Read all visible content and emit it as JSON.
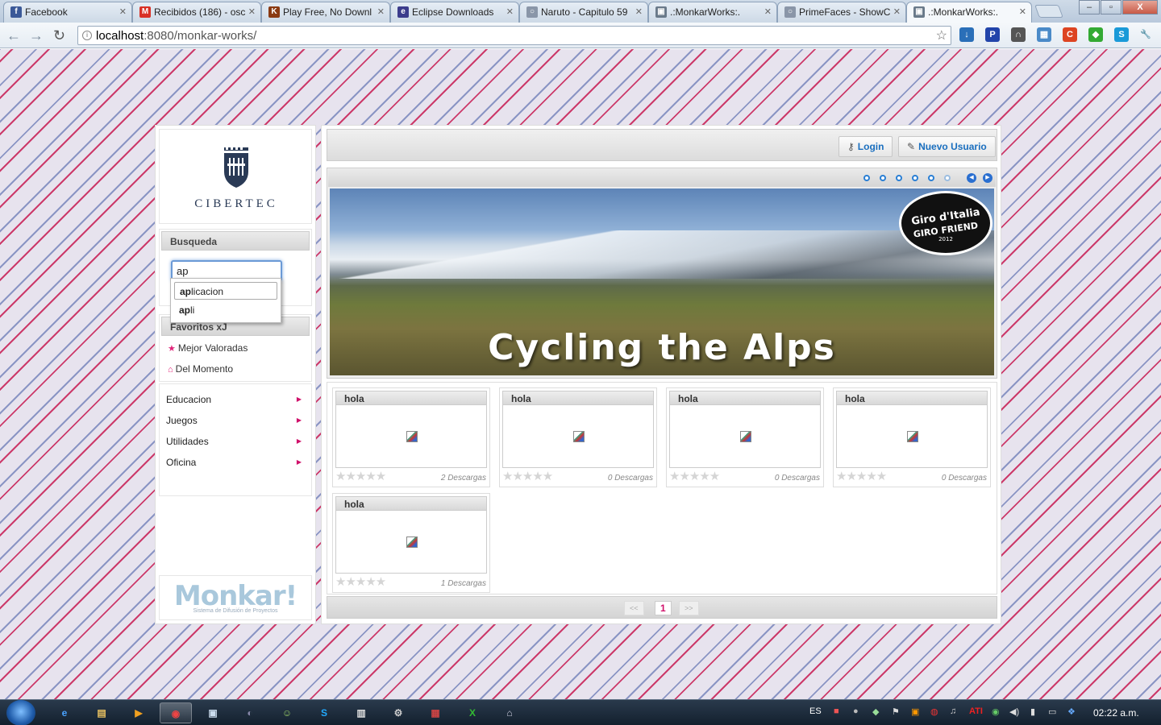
{
  "browser": {
    "tabs": [
      {
        "title": "Facebook",
        "icon": "facebook-icon",
        "color": "#3b5998",
        "glyph": "f"
      },
      {
        "title": "Recibidos (186) - osc",
        "icon": "gmail-icon",
        "color": "#d93025",
        "glyph": "M"
      },
      {
        "title": "Play Free, No Downl",
        "icon": "kongregate-icon",
        "color": "#8a3a12",
        "glyph": "K"
      },
      {
        "title": "Eclipse Downloads",
        "icon": "eclipse-icon",
        "color": "#3c3c8c",
        "glyph": "e"
      },
      {
        "title": "Naruto - Capitulo 59",
        "icon": "page-icon",
        "color": "#8a96a8",
        "glyph": "○"
      },
      {
        "title": ".:MonkarWorks:.",
        "icon": "broken-image-icon",
        "color": "#6a7a8a",
        "glyph": "▣"
      },
      {
        "title": "PrimeFaces - ShowC",
        "icon": "page-icon",
        "color": "#8a96a8",
        "glyph": "○"
      },
      {
        "title": ".:MonkarWorks:.",
        "icon": "broken-image-icon",
        "color": "#6a7a8a",
        "glyph": "▣"
      }
    ],
    "url_host": "localhost",
    "url_rest": ":8080/monkar-works/",
    "window_buttons": [
      "–",
      "▫",
      "X"
    ]
  },
  "sidebar": {
    "logo_text": "CIBERTEC",
    "search": {
      "title": "Busqueda",
      "value": "ap"
    },
    "autocomplete": [
      {
        "match": "ap",
        "rest": "licacion"
      },
      {
        "match": "ap",
        "rest": "li"
      }
    ],
    "favorites": {
      "title": "Favoritos xJ",
      "items": [
        {
          "label": "Mejor Valoradas",
          "icon": "star-icon"
        },
        {
          "label": "Del Momento",
          "icon": "gift-icon"
        }
      ]
    },
    "categories": [
      "Educacion",
      "Juegos",
      "Utilidades",
      "Oficina"
    ],
    "footer_brand": "Monkar!",
    "footer_sub": "Sistema de Difusión de Proyectos"
  },
  "header": {
    "login": "Login",
    "new_user": "Nuevo Usuario"
  },
  "gallery": {
    "slides": 6,
    "active_slide": 6,
    "banner_title": "Cycling the Alps",
    "badge_line1": "Giro d'Italia",
    "badge_line2": "GIRO FRIEND",
    "badge_year": "2012"
  },
  "projects": [
    {
      "title": "hola",
      "downloads": "2 Descargas"
    },
    {
      "title": "hola",
      "downloads": "0 Descargas"
    },
    {
      "title": "hola",
      "downloads": "0 Descargas"
    },
    {
      "title": "hola",
      "downloads": "0 Descargas"
    },
    {
      "title": "hola",
      "downloads": "1 Descargas"
    }
  ],
  "pager": {
    "prev": "<<",
    "current": "1",
    "next": ">>"
  },
  "taskbar": {
    "language": "ES",
    "clock": "02:22 a.m."
  }
}
